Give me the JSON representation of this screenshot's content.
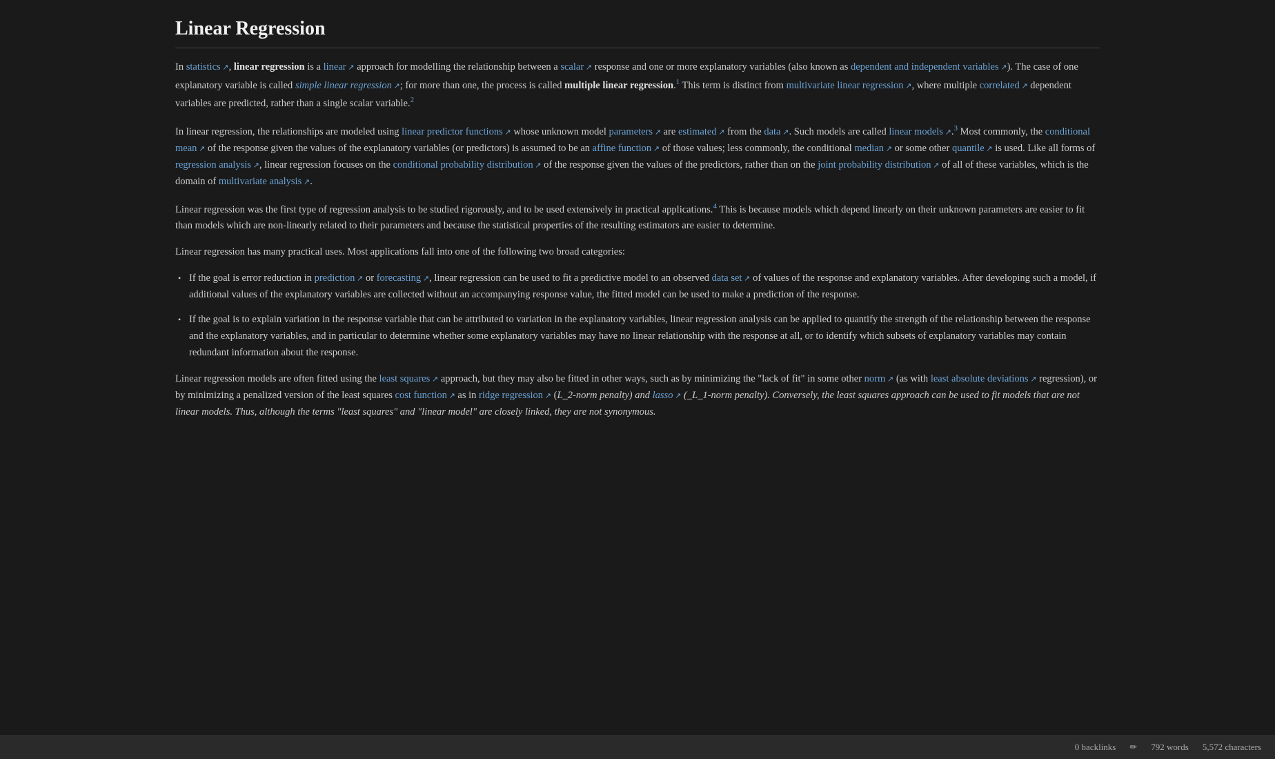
{
  "page": {
    "title": "Linear Regression",
    "bottom_bar": {
      "backlinks": "0 backlinks",
      "words": "792 words",
      "characters": "5,572 characters",
      "edit_icon": "✏"
    }
  },
  "content": {
    "para1": {
      "text_before_stats": "In ",
      "stats_link": "statistics",
      "text_after_stats": ", ",
      "bold_linear": "linear regression",
      "text_is": " is a ",
      "linear_link": "linear",
      "text_approach": " approach for modelling the relationship between a ",
      "scalar_link": "scalar",
      "text_response": " response and one or more explanatory variables (also known as ",
      "dep_link": "dependent and independent variables",
      "text_case": "). The case of one explanatory variable is called ",
      "simple_link": "simple linear regression",
      "text_more": "; for more than one, the process is called ",
      "bold_multiple": "multiple linear regression",
      "cite1": "1",
      "cite1_url": "https://en.wikipedia.org/wiki/Linear_regression#cite_note-Freedman09-1",
      "text_distinct": " This term is distinct from ",
      "multivariate_link": "multivariate linear regression",
      "text_where": ", where multiple ",
      "correlated_link": "correlated",
      "text_dep_vars": " dependent variables are predicted, rather than a single scalar variable.",
      "cite2": "2",
      "cite2_url": "https://en.wikipedia.org/wiki/Linear_regression#cite_note-2"
    },
    "para2_text": "In linear regression, the relationships are modeled using ",
    "linear_predictor_link": "linear predictor functions",
    "para2b": " whose unknown model ",
    "parameters_link": "parameters",
    "para2c": " are ",
    "estimated_link": "estimated",
    "para2d": " from the ",
    "data_link": "data",
    "para2e": ". Such models are called ",
    "linear_models_link": "linear models",
    "para2f": ".",
    "cite3": "3",
    "cite3_url": "https://en.wikipedia.org/wiki/Linear_regression#cite_note-3",
    "para2g": " Most commonly, the ",
    "conditional_mean_link": "conditional mean",
    "para2h": " of the response given the values of the explanatory variables (or predictors) is assumed to be an ",
    "affine_link": "affine function",
    "para2i": " of those values; less commonly, the conditional ",
    "median_link": "median",
    "para2j": " or some other ",
    "quantile_link": "quantile",
    "para2k": " is used. Like all forms of ",
    "regression_analysis_link": "regression analysis",
    "para2l": ", linear regression focuses on the ",
    "cond_prob_link": "conditional probability distribution",
    "para2m": " of the response given the values of the predictors, rather than on the ",
    "joint_prob_link": "joint probability distribution",
    "para2n": " of all of these variables, which is the domain of ",
    "multivariate_analysis_link": "multivariate analysis",
    "para2o": ".",
    "para3": "Linear regression was the first type of regression analysis to be studied rigorously, and to be used extensively in practical applications.",
    "cite4": "4",
    "cite4_url": "https://en.wikipedia.org/wiki/Linear_regression#cite_note-4",
    "para3b": " This is because models which depend linearly on their unknown parameters are easier to fit than models which are non-linearly related to their parameters and because the statistical properties of the resulting estimators are easier to determine.",
    "para4": "Linear regression has many practical uses. Most applications fall into one of the following two broad categories:",
    "bullet1_a": "If the goal is error reduction in ",
    "prediction_link": "prediction",
    "bullet1_b": " or ",
    "forecasting_link": "forecasting",
    "bullet1_c": ", linear regression can be used to fit a predictive model to an observed ",
    "data_set_link": "data set",
    "bullet1_d": " of values of the response and explanatory variables. After developing such a model, if additional values of the explanatory variables are collected without an accompanying response value, the fitted model can be used to make a prediction of the response.",
    "bullet2": "If the goal is to explain variation in the response variable that can be attributed to variation in the explanatory variables, linear regression analysis can be applied to quantify the strength of the relationship between the response and the explanatory variables, and in particular to determine whether some explanatory variables may have no linear relationship with the response at all, or to identify which subsets of explanatory variables may contain redundant information about the response.",
    "para5_a": "Linear regression models are often fitted using the ",
    "least_squares_link": "least squares",
    "para5_b": " approach, but they may also be fitted in other ways, such as by minimizing the \"lack of fit\" in some other ",
    "norm_link": "norm",
    "para5_c": " (as with ",
    "least_abs_link": "least absolute deviations",
    "para5_d": " regression), or by minimizing a penalized version of the least squares ",
    "cost_function_link": "cost function",
    "para5_e": " as in ",
    "ridge_link": "ridge regression",
    "para5_f": " (L_2-norm penalty) and ",
    "lasso_link": "lasso",
    "para5_g": " (L_1-norm penalty). ",
    "italic_text": "Conversely, the least squares approach can be used to fit models that are not linear models. Thus, although the terms \"least squares\" and \"linear model\" are closely linked, they are not synonymous."
  }
}
